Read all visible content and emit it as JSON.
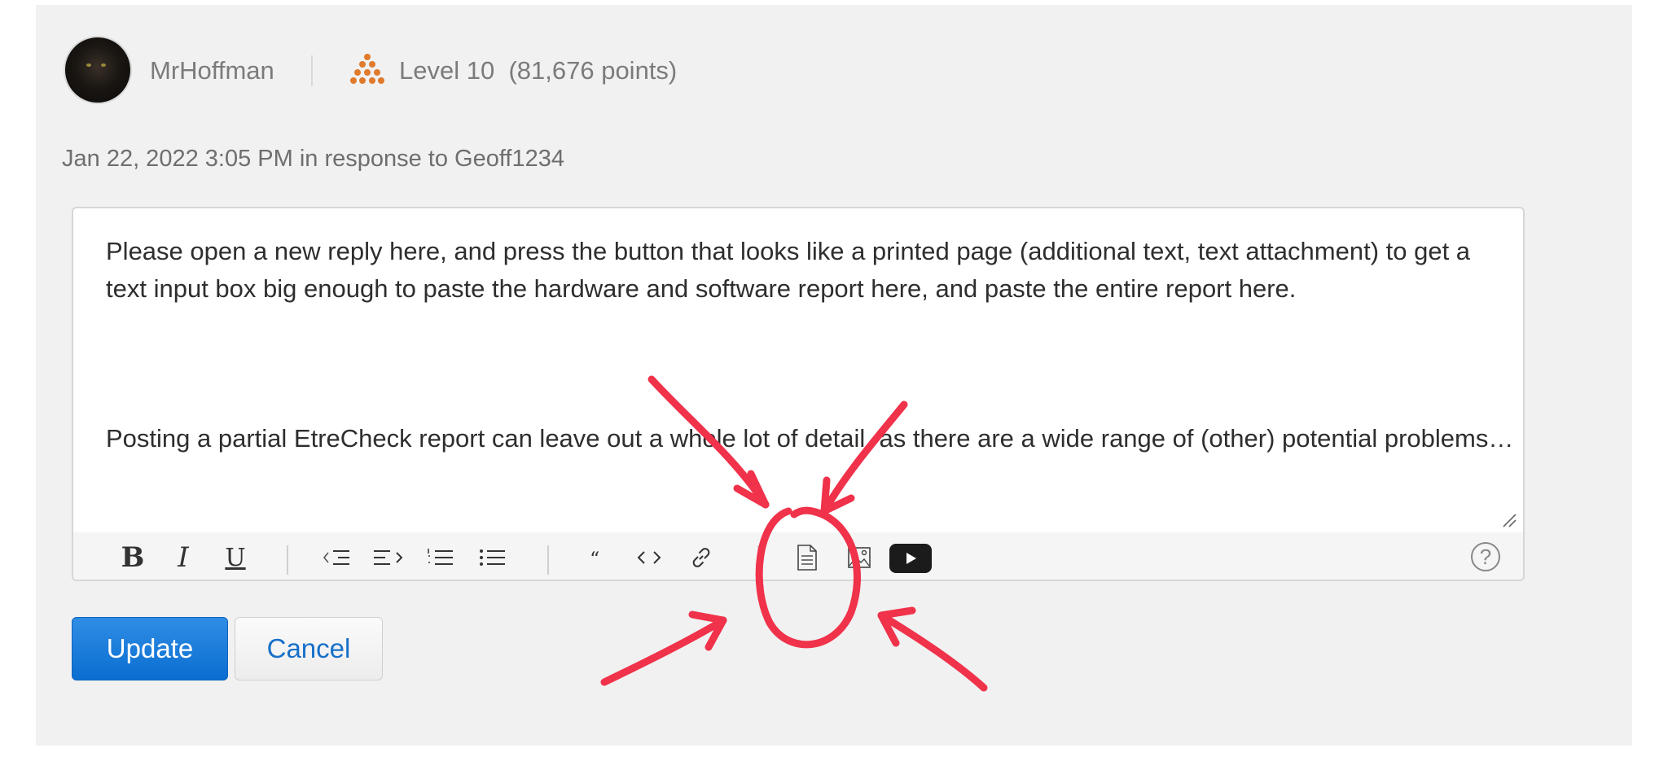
{
  "author": {
    "username": "MrHoffman",
    "level": "Level 10",
    "points": "(81,676 points)"
  },
  "post_meta": "Jan 22, 2022 3:05 PM in response to Geoff1234",
  "editor": {
    "paragraph_1": "Please open a new reply here, and press the button that looks like a printed page (additional text, text attachment) to get a text input box big enough to paste the hardware and software report here, and paste the entire report here.",
    "paragraph_2": "Posting a partial EtreCheck report can leave out a whole lot of detail, as there are a wide range of (other) potential problems…"
  },
  "toolbar": {
    "bold": "B",
    "italic": "I",
    "underline": "U",
    "help": "?"
  },
  "actions": {
    "update_label": "Update",
    "cancel_label": "Cancel"
  },
  "colors": {
    "accent": "#0a6ed1",
    "level_icon": "#e07a2c",
    "annotation": "#f0324a"
  },
  "icons": [
    "bold-icon",
    "italic-icon",
    "underline-icon",
    "outdent-icon",
    "indent-icon",
    "numbered-list-icon",
    "bulleted-list-icon",
    "quote-icon",
    "code-icon",
    "link-icon",
    "document-icon",
    "image-icon",
    "video-icon",
    "help-icon"
  ]
}
